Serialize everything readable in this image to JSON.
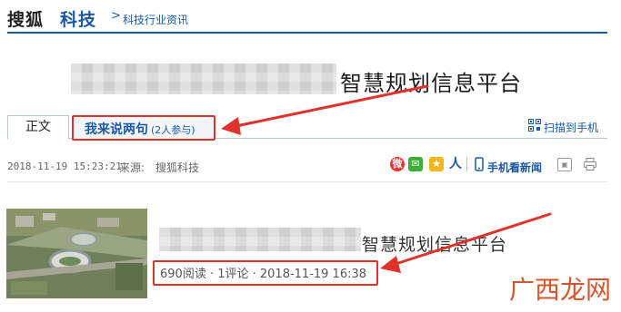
{
  "header": {
    "brand_sohu": "搜狐",
    "brand_tech": "科技",
    "breadcrumb_sep": ">",
    "breadcrumb": "科技行业资讯"
  },
  "article": {
    "title_visible": "智慧规划信息平台"
  },
  "tabs": {
    "main": "正文",
    "comment_label": "我来说两句",
    "comment_count": "(2人参与)"
  },
  "scan": {
    "label": "扫描到手机"
  },
  "meta": {
    "date": "2018-11-19 15:23:21",
    "source_label": "来源:",
    "source_value": "搜狐科技",
    "share_people": "人",
    "mobile_label": "手机看新闻"
  },
  "card": {
    "title_visible": "智慧规划信息平台",
    "meta": "690阅读 · 1评论 · 2018-11-19 16:38"
  },
  "watermark": "广西龙网",
  "colors": {
    "brand_blue": "#1a58a3",
    "highlight_red": "#e0322b"
  }
}
